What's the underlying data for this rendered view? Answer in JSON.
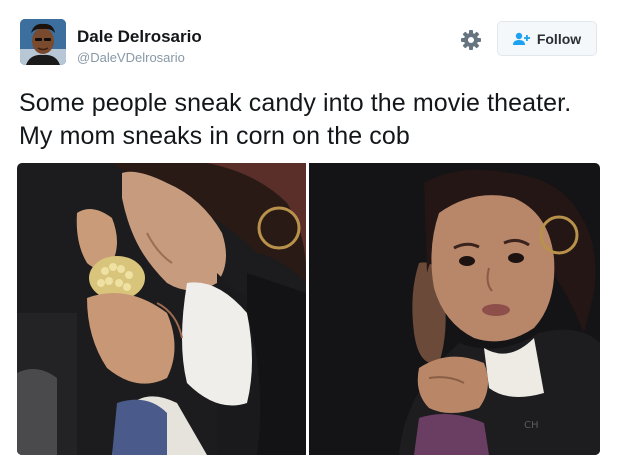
{
  "user": {
    "display_name": "Dale Delrosario",
    "handle": "@DaleVDelrosario",
    "avatar_icon": "avatar-photo"
  },
  "actions": {
    "settings_icon": "gear-icon",
    "follow_icon": "add-user-icon",
    "follow_label": "Follow"
  },
  "tweet": {
    "text": "Some people sneak candy into the movie theater. My mom sneaks in corn on the cob"
  },
  "media": {
    "photos": [
      {
        "alt": "woman eating corn on the cob"
      },
      {
        "alt": "woman looking at camera"
      }
    ]
  },
  "colors": {
    "text": "#14171a",
    "secondary_text": "#8899a6",
    "follow_accent": "#1da1f2",
    "button_bg": "#f5f8fa",
    "button_border": "#e1e8ed"
  }
}
